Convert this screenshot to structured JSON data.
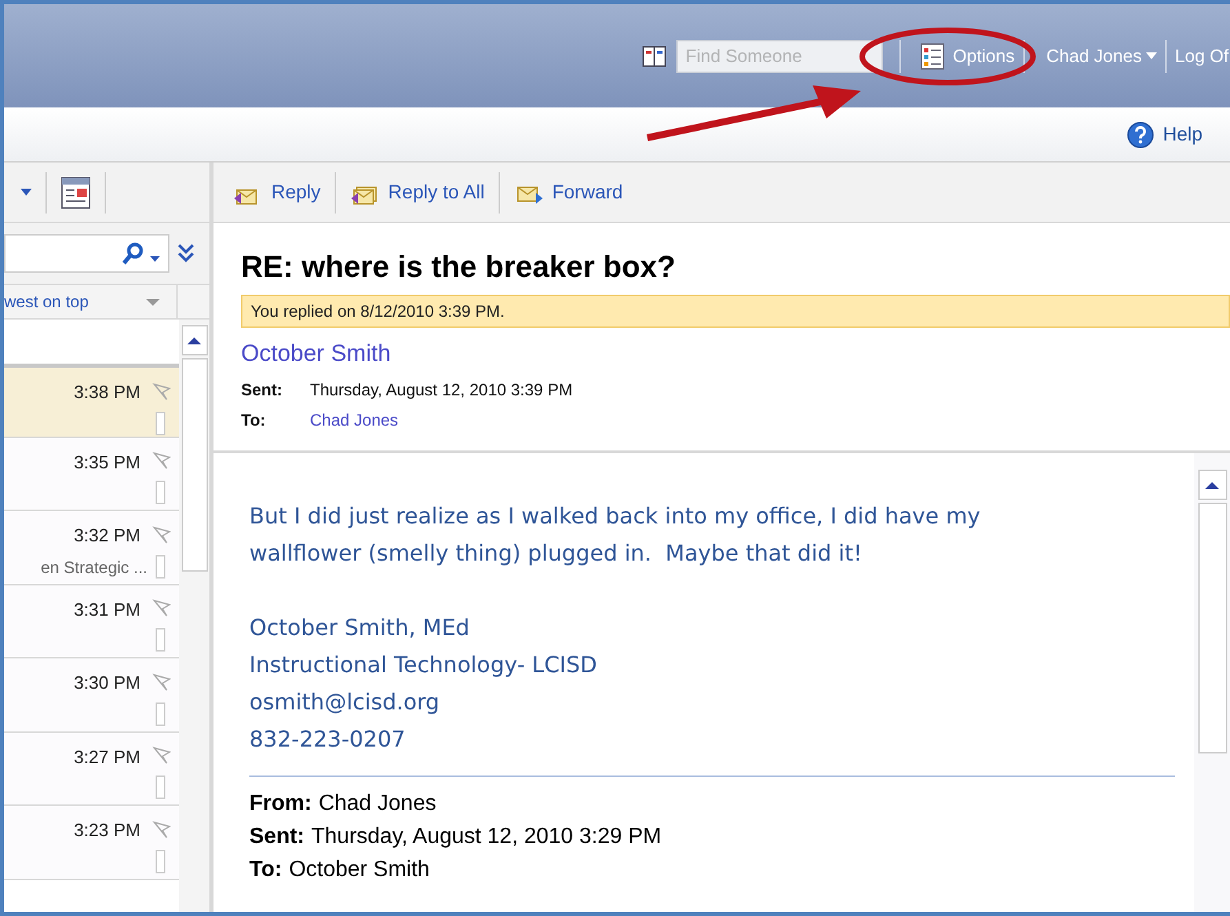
{
  "header": {
    "find_placeholder": "Find Someone",
    "options": "Options",
    "user": "Chad Jones",
    "log_off": "Log Of"
  },
  "help": "Help",
  "message_list": {
    "sort_label": "west on top",
    "rows": [
      {
        "time": "3:38 PM",
        "preview": "",
        "selected": true
      },
      {
        "time": "3:35 PM",
        "preview": "",
        "selected": false
      },
      {
        "time": "3:32 PM",
        "preview": "en Strategic ...",
        "selected": false
      },
      {
        "time": "3:31 PM",
        "preview": "",
        "selected": false
      },
      {
        "time": "3:30 PM",
        "preview": "",
        "selected": false
      },
      {
        "time": "3:27 PM",
        "preview": "",
        "selected": false
      },
      {
        "time": "3:23 PM",
        "preview": "",
        "selected": false
      }
    ]
  },
  "reading_toolbar": [
    {
      "label": "Reply",
      "kind": "reply"
    },
    {
      "label": "Reply to All",
      "kind": "replyall"
    },
    {
      "label": "Forward",
      "kind": "forward"
    }
  ],
  "message": {
    "subject": "RE: where is the breaker box?",
    "info_bar": "You replied on 8/12/2010 3:39 PM.",
    "sender": "October Smith",
    "headers": [
      {
        "label": "Sent:",
        "value": "Thursday, August 12, 2010 3:39 PM",
        "kind": "text"
      },
      {
        "label": "To:",
        "value": "Chad Jones",
        "kind": "link"
      }
    ],
    "body": [
      "But I did just realize as I walked back into my office, I did have my",
      "wallflower (smelly thing) plugged in.  Maybe that did it!"
    ],
    "signature": [
      "October Smith, MEd",
      "Instructional Technology- LCISD",
      "osmith@lcisd.org",
      "832-223-0207"
    ],
    "quoted_headers": [
      {
        "label": "From:",
        "value": "Chad Jones"
      },
      {
        "label": "Sent:",
        "value": "Thursday, August 12, 2010 3:29 PM"
      },
      {
        "label": "To:",
        "value": "October Smith"
      }
    ]
  }
}
